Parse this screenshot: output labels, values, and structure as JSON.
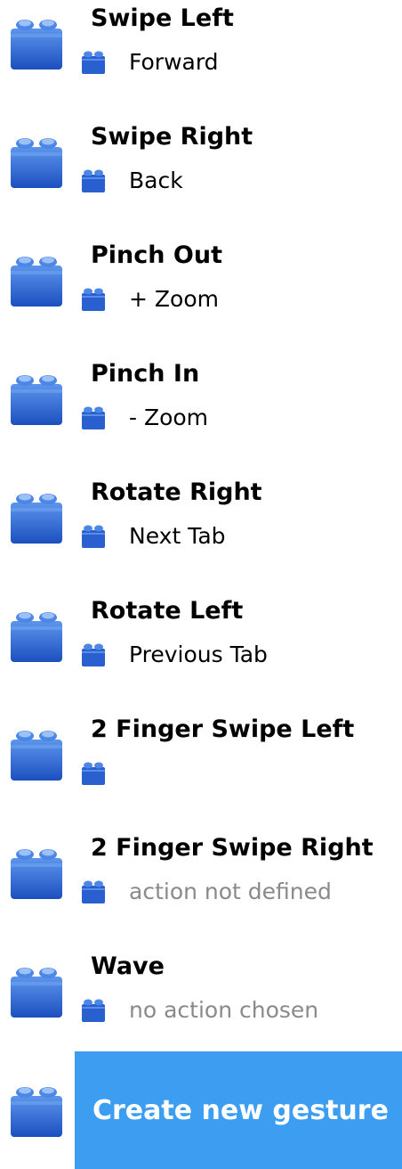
{
  "colors": {
    "icon_blue": "#1c4fbf",
    "icon_light": "#4c86e6",
    "accent": "#3d9df0",
    "placeholder_text": "#8a8a8a"
  },
  "icons": {
    "gesture": "brick-icon",
    "action": "small-brick-icon"
  },
  "gestures": [
    {
      "title": "Swipe Left",
      "action": "Forward"
    },
    {
      "title": "Swipe Right",
      "action": "Back"
    },
    {
      "title": "Pinch Out",
      "action": "+ Zoom"
    },
    {
      "title": "Pinch In",
      "action": "- Zoom"
    },
    {
      "title": "Rotate Right",
      "action": "Next Tab"
    },
    {
      "title": "Rotate Left",
      "action": "Previous Tab"
    },
    {
      "title": "2 Finger Swipe Left",
      "action": ""
    },
    {
      "title": "2 Finger Swipe Right",
      "action": "action not defined"
    },
    {
      "title": "Wave",
      "action": "no action chosen"
    }
  ],
  "create_button_label": "Create new gesture"
}
